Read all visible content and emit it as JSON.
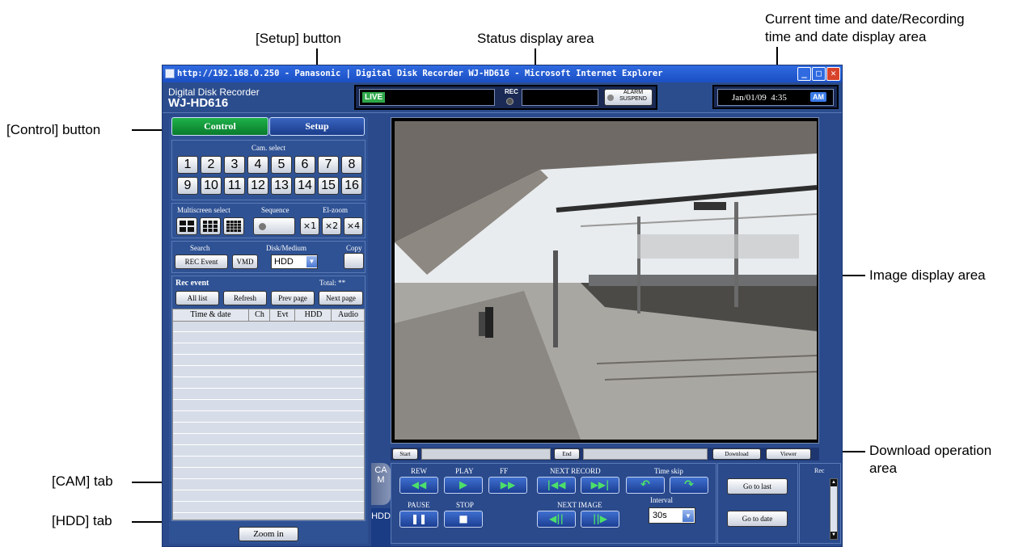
{
  "annotations": {
    "setup_button": "[Setup] button",
    "status_area": "Status display area",
    "time_area_line1": "Current time and date/Recording",
    "time_area_line2": "time and date display area",
    "control_button": "[Control] button",
    "image_area": "Image display area",
    "download_area_line1": "Download operation",
    "download_area_line2": "area",
    "cam_tab": "[CAM] tab",
    "hdd_tab": "[HDD] tab"
  },
  "window": {
    "title": "http://192.168.0.250 - Panasonic | Digital Disk Recorder WJ-HD616 - Microsoft Internet Explorer",
    "min": "_",
    "max": "□",
    "close": "✕"
  },
  "header": {
    "brand_sub": "Digital Disk Recorder",
    "brand_model": "WJ-HD616",
    "live": "LIVE",
    "rec": "REC",
    "alarm_suspend": "ALARM SUSPEND",
    "datetime": "Jan/01/09  4:35",
    "ampm": "AM"
  },
  "tabs": {
    "control": "Control",
    "setup": "Setup"
  },
  "cam_select": {
    "label": "Cam. select",
    "cameras": [
      "1",
      "2",
      "3",
      "4",
      "5",
      "6",
      "7",
      "8",
      "9",
      "10",
      "11",
      "12",
      "13",
      "14",
      "15",
      "16"
    ]
  },
  "multiscreen": {
    "label": "Multiscreen select"
  },
  "sequence": {
    "label": "Sequence"
  },
  "el_zoom": {
    "label": "El-zoom",
    "x1": "×1",
    "x2": "×2",
    "x4": "×4"
  },
  "search": {
    "label": "Search",
    "rec_event": "REC Event",
    "vmd": "VMD"
  },
  "disk": {
    "label": "Disk/Medium",
    "value": "HDD"
  },
  "copy": {
    "label": "Copy"
  },
  "rec_event": {
    "title": "Rec event",
    "total": "Total: **",
    "all_list": "All list",
    "refresh": "Refresh",
    "prev_page": "Prev page",
    "next_page": "Next page",
    "columns": [
      "Time & date",
      "Ch",
      "Evt",
      "HDD",
      "Audio"
    ]
  },
  "zoom_in": "Zoom in",
  "side_tabs": {
    "cam": "CAM",
    "hdd": "HDD"
  },
  "download": {
    "start": "Start",
    "end": "End",
    "download": "Download",
    "viewer": "Viewer"
  },
  "playback": {
    "rew": "REW",
    "play": "PLAY",
    "ff": "FF",
    "next_record": "NEXT RECORD",
    "time_skip": "Time skip",
    "pause": "PAUSE",
    "stop": "STOP",
    "next_image": "NEXT IMAGE",
    "interval": "Interval",
    "interval_value": "30s",
    "go_to_last": "Go to last",
    "go_to_date": "Go to date",
    "rec": "Rec"
  }
}
